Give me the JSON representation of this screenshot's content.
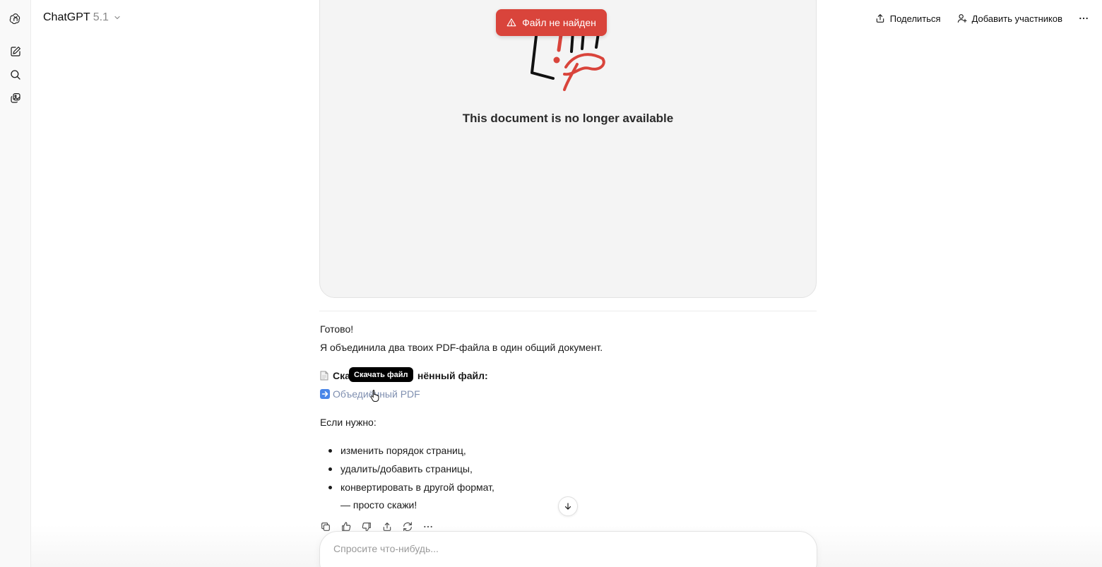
{
  "header": {
    "model_name": "ChatGPT",
    "model_version": "5.1",
    "share_label": "Поделиться",
    "add_participants_label": "Добавить участников"
  },
  "toast": {
    "text": "Файл не найден",
    "color": "#d9443b"
  },
  "preview": {
    "message": "This document is no longer available"
  },
  "message": {
    "line1": "Готово!",
    "line2": "Я объединила два твоих PDF-файла в один общий документ.",
    "download_prefix": "Ска",
    "download_suffix": "нённый файл:",
    "link_prefix": "Объеди",
    "link_suffix": "ённый PDF",
    "if_needed": "Если нужно:",
    "bullets": [
      "изменить порядок страниц,",
      "удалить/добавить страницы,",
      "конвертировать в другой формат,"
    ],
    "tail": "— просто скажи!"
  },
  "tooltip": {
    "text": "Скачать файл"
  },
  "composer": {
    "placeholder": "Спросите что-нибудь..."
  },
  "icons": {
    "rail": [
      "openai-logo-icon",
      "new-chat-icon",
      "search-icon",
      "library-icon"
    ],
    "message_actions": [
      "copy-icon",
      "thumbs-up-icon",
      "thumbs-down-icon",
      "share-icon",
      "regenerate-icon",
      "more-icon"
    ]
  },
  "colors": {
    "toast": "#d9443b",
    "link": "#7f8fb0",
    "preview_bg": "#f4f4f4"
  }
}
